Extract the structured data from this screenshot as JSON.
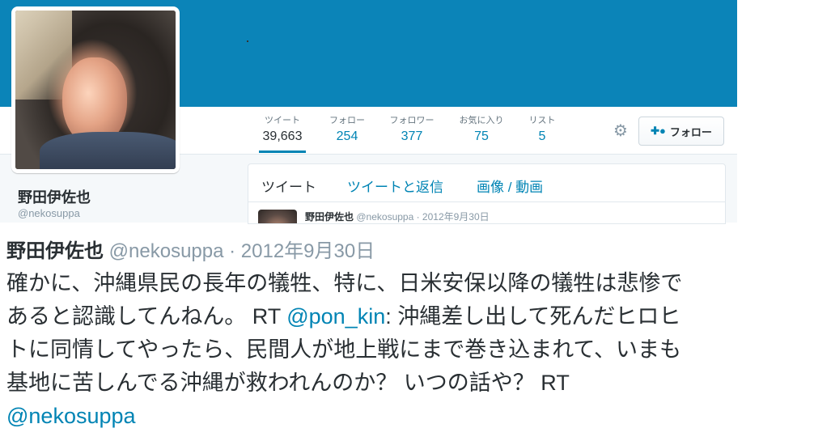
{
  "profile": {
    "display_name": "野田伊佐也",
    "screen_name": "@nekosuppa"
  },
  "stats": [
    {
      "label": "ツイート",
      "value": "39,663"
    },
    {
      "label": "フォロー",
      "value": "254"
    },
    {
      "label": "フォロワー",
      "value": "377"
    },
    {
      "label": "お気に入り",
      "value": "75"
    },
    {
      "label": "リスト",
      "value": "5"
    }
  ],
  "actions": {
    "follow_label": "フォロー",
    "settings_icon": "gear-icon",
    "follow_icon": "add-user-icon"
  },
  "timeline": {
    "tabs": [
      "ツイート",
      "ツイートと返信",
      "画像 / 動画"
    ],
    "tweet_header": {
      "name": "野田伊佐也",
      "meta": "@nekosuppa · 2012年9月30日"
    }
  },
  "tweet": {
    "name": "野田伊佐也",
    "meta": "@nekosuppa · 2012年9月30日",
    "line1": "確かに、沖縄県民の長年の犠牲、特に、日米安保以降の犠牲は悲惨で",
    "line2_a": "あると認識してんねん。 RT ",
    "line2_link": "@pon_kin",
    "line2_b": ": 沖縄差し出して死んだヒロヒ",
    "line3": "トに同情してやったら、民間人が地上戦にまで巻き込まれて、いまも",
    "line4": "基地に苦しんでる沖縄が救われんのか？ いつの話や？ RT",
    "line5_link": "@nekosuppa"
  },
  "colors": {
    "banner": "#0b84b8",
    "link": "#0084b4",
    "text": "#292f33",
    "muted": "#8899a6"
  }
}
